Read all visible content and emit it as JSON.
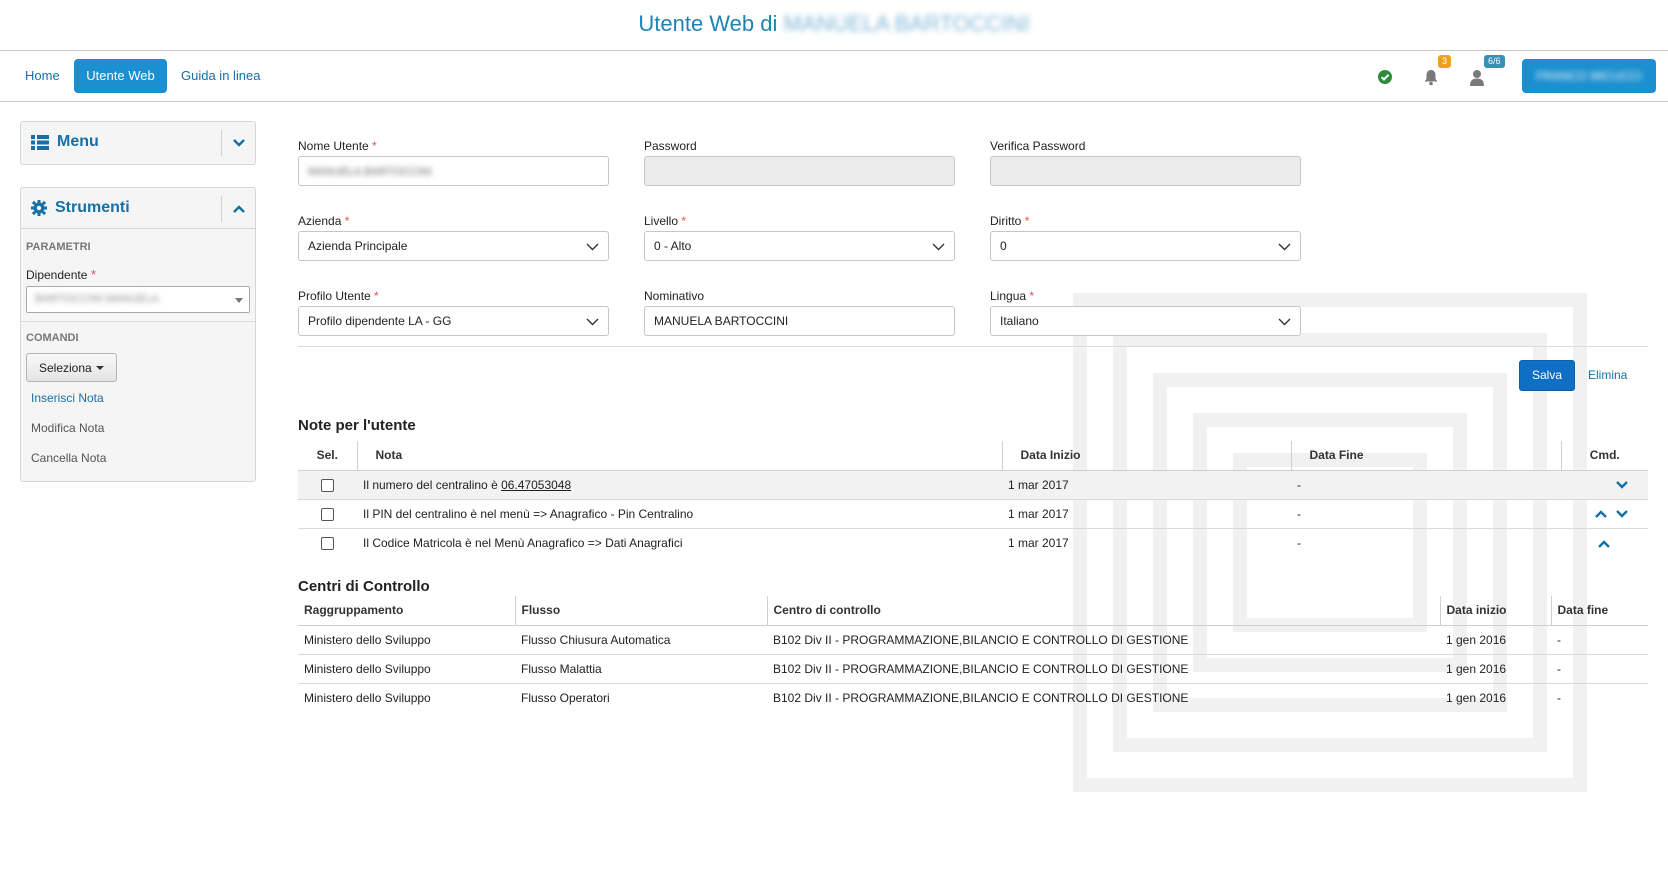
{
  "header": {
    "title_prefix": "Utente Web di",
    "title_user": "MANUELA BARTOCCINI"
  },
  "nav": {
    "home": "Home",
    "utente_web": "Utente Web",
    "guida": "Guida in linea",
    "notifications_badge": "3",
    "users_badge": "6/6",
    "user_button": "FRANCO MICUCCI"
  },
  "sidebar": {
    "menu_title": "Menu",
    "tools_title": "Strumenti",
    "params_label": "PARAMETRI",
    "dipendente_label": "Dipendente",
    "dipendente_value": "BARTOCCINI MANUELA",
    "commands_label": "COMANDI",
    "seleziona": "Seleziona",
    "commands": [
      "Inserisci Nota",
      "Modifica Nota",
      "Cancella Nota"
    ]
  },
  "form": {
    "nome_utente": {
      "label": "Nome Utente",
      "value": "MANUELA.BARTOCCINI"
    },
    "password": {
      "label": "Password",
      "value": ""
    },
    "verifica_password": {
      "label": "Verifica Password",
      "value": ""
    },
    "azienda": {
      "label": "Azienda",
      "value": "Azienda Principale"
    },
    "livello": {
      "label": "Livello",
      "value": "0 - Alto"
    },
    "diritto": {
      "label": "Diritto",
      "value": "0"
    },
    "profilo_utente": {
      "label": "Profilo Utente",
      "value": "Profilo dipendente LA - GG"
    },
    "nominativo": {
      "label": "Nominativo",
      "value": "MANUELA BARTOCCINI"
    },
    "lingua": {
      "label": "Lingua",
      "value": "Italiano"
    },
    "required_mark": "*",
    "salva": "Salva",
    "elimina": "Elimina"
  },
  "notes": {
    "title": "Note per l'utente",
    "columns": [
      "Sel.",
      "Nota",
      "Data Inizio",
      "Data Fine",
      "Cmd."
    ],
    "rows": [
      {
        "nota_text": "Il numero del centralino è ",
        "nota_link": "06.47053048",
        "data_inizio": "1 mar 2017",
        "data_fine": "-"
      },
      {
        "nota_text": "Il PIN del centralino è nel menù => Anagrafico - Pin Centralino",
        "nota_link": "",
        "data_inizio": "1 mar 2017",
        "data_fine": "-"
      },
      {
        "nota_text": "Il Codice Matricola è nel Menù Anagrafico => Dati Anagrafici",
        "nota_link": "",
        "data_inizio": "1 mar 2017",
        "data_fine": "-"
      }
    ]
  },
  "centri": {
    "title": "Centri di Controllo",
    "columns": [
      "Raggruppamento",
      "Flusso",
      "Centro di controllo",
      "Data inizio",
      "Data fine"
    ],
    "rows": [
      [
        "Ministero dello Sviluppo",
        "Flusso Chiusura Automatica",
        "B102 Div II - PROGRAMMAZIONE,BILANCIO E CONTROLLO DI GESTIONE",
        "1 gen 2016",
        "-"
      ],
      [
        "Ministero dello Sviluppo",
        "Flusso Malattia",
        "B102 Div II - PROGRAMMAZIONE,BILANCIO E CONTROLLO DI GESTIONE",
        "1 gen 2016",
        "-"
      ],
      [
        "Ministero dello Sviluppo",
        "Flusso Operatori",
        "B102 Div II - PROGRAMMAZIONE,BILANCIO E CONTROLLO DI GESTIONE",
        "1 gen 2016",
        "-"
      ]
    ]
  },
  "colors": {
    "accent": "#1b8fcf",
    "link": "#1570a6",
    "primary_button": "#0f6fc4",
    "success": "#2e8b3a",
    "warning_badge": "#f0a020",
    "info_badge": "#3a8fb7",
    "required": "#d9534f"
  }
}
